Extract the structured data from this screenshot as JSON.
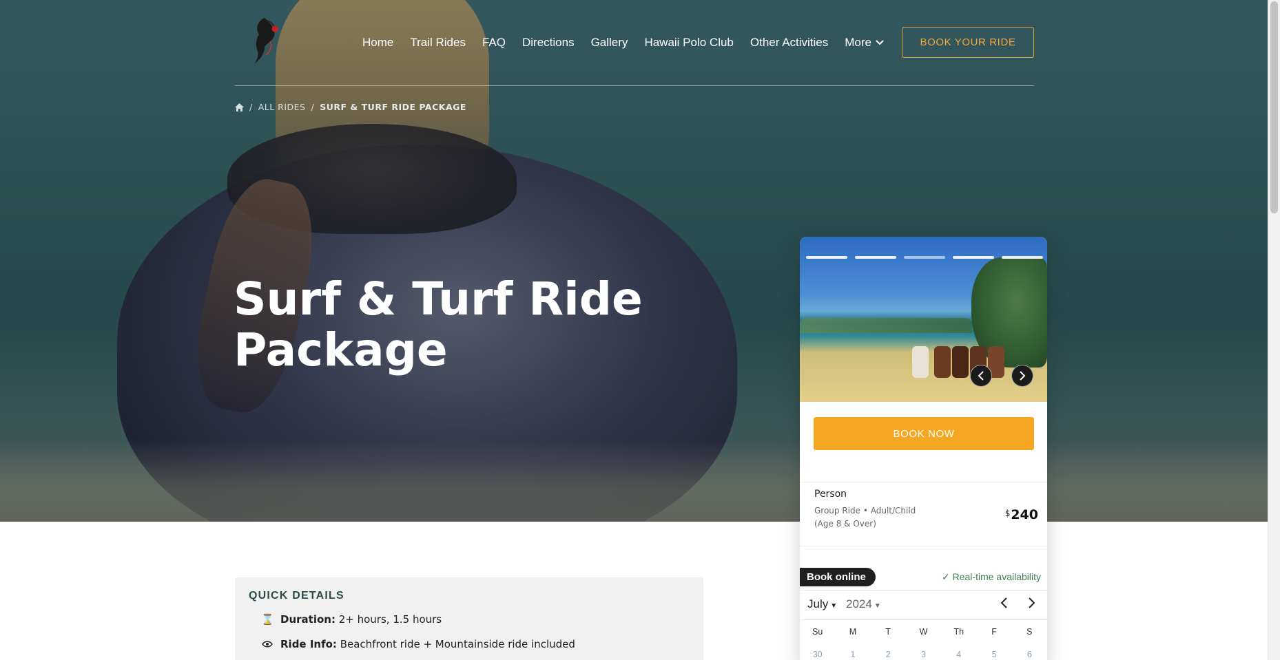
{
  "nav": {
    "items": [
      "Home",
      "Trail Rides",
      "FAQ",
      "Directions",
      "Gallery",
      "Hawaii Polo Club",
      "Other Activities",
      "More"
    ],
    "more_icon": "chevron-down-icon",
    "book_button": "BOOK YOUR RIDE"
  },
  "breadcrumb": {
    "home_icon": "home-icon",
    "sep": "/",
    "all_rides": "ALL RIDES",
    "current": "SURF & TURF RIDE PACKAGE"
  },
  "hero": {
    "title": "Surf & Turf Ride Package"
  },
  "widget": {
    "book_now": "BOOK NOW",
    "price_title": "Person",
    "price_desc": "Group Ride • Adult/Child (Age 8 & Over)",
    "currency": "$",
    "price": "240",
    "book_online": "Book online",
    "realtime": "✓ Real-time availability",
    "month": "July",
    "year": "2024",
    "weekdays": [
      "Su",
      "M",
      "T",
      "W",
      "Th",
      "F",
      "S"
    ],
    "first_week": [
      "30",
      "1",
      "2",
      "3",
      "4",
      "5",
      "6"
    ],
    "accent_color": "#f5a623"
  },
  "quick_details": {
    "title": "QUICK DETAILS",
    "duration_label": "Duration:",
    "duration_value": "2+ hours, 1.5 hours",
    "ride_info_label": "Ride Info:",
    "ride_info_value": "Beachfront ride + Mountainside ride included"
  }
}
